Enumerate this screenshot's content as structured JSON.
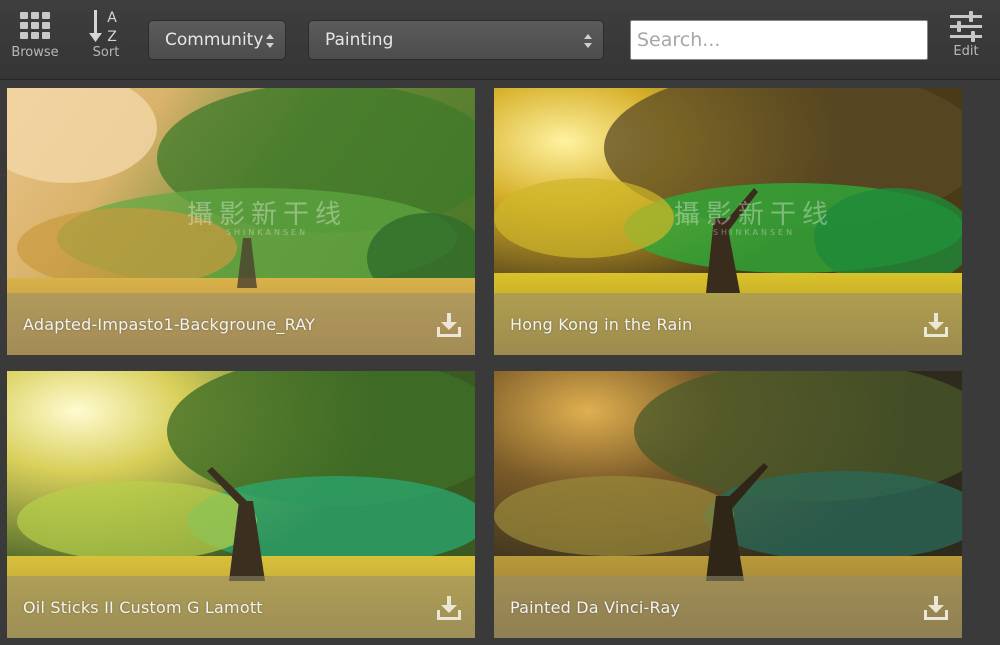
{
  "toolbar": {
    "browse_label": "Browse",
    "sort_label": "Sort",
    "sort_icon_letters": [
      "A",
      "Z"
    ],
    "collection_select": "Community",
    "category_select": "Painting",
    "search_placeholder": "Search...",
    "edit_label": "Edit"
  },
  "watermark": {
    "text": "攝影新干线",
    "sub": "SHINKANSEN"
  },
  "presets": [
    {
      "title": "Adapted-Impasto1-Backgroune_RAY"
    },
    {
      "title": "Hong Kong in the Rain"
    },
    {
      "title": "Oil Sticks II Custom G Lamott"
    },
    {
      "title": "Painted Da Vinci-Ray"
    }
  ],
  "icons": {
    "browse": "grid-icon",
    "sort": "sort-az-icon",
    "edit": "sliders-icon",
    "download": "download-icon"
  }
}
